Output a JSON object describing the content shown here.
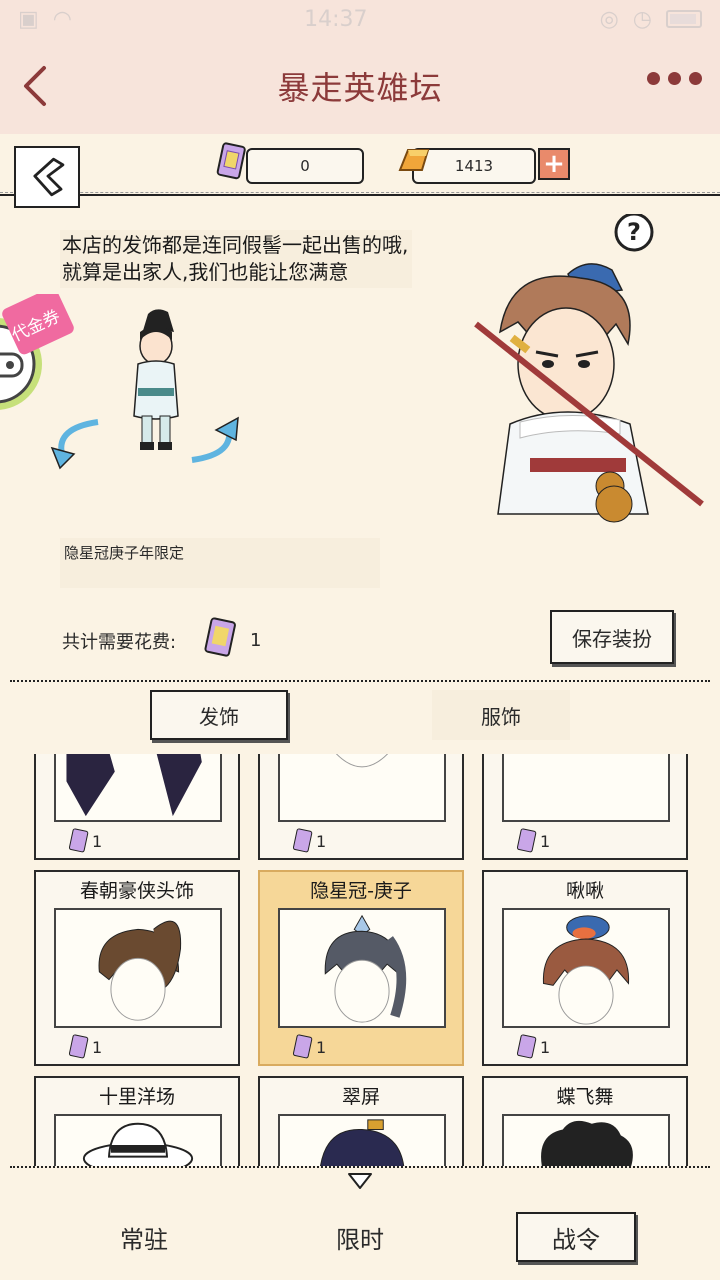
{
  "status": {
    "time": "14:37"
  },
  "app": {
    "title": "暴走英雄坛"
  },
  "currency": {
    "ticket": "0",
    "gold": "1413"
  },
  "shop": {
    "speech": "本店的发饰都是连同假髻一起出售的哦,就算是出家人,我们也能让您满意",
    "coupon_tab": "代金券",
    "selected_item_name": "隐星冠庚子年限定",
    "cost_label": "共计需要花费:",
    "cost_value": "1",
    "save_button": "保存装扮"
  },
  "categories": {
    "hair": "发饰",
    "clothes": "服饰"
  },
  "items": [
    {
      "name": "",
      "price": "1"
    },
    {
      "name": "",
      "price": "1"
    },
    {
      "name": "",
      "price": "1"
    },
    {
      "name": "春朝豪侠头饰",
      "price": "1"
    },
    {
      "name": "隐星冠-庚子",
      "price": "1"
    },
    {
      "name": "啾啾",
      "price": "1"
    },
    {
      "name": "十里洋场",
      "price": ""
    },
    {
      "name": "翠屏",
      "price": ""
    },
    {
      "name": "蝶飞舞",
      "price": ""
    }
  ],
  "bottom_tabs": {
    "regular": "常驻",
    "limited": "限时",
    "battle_pass": "战令"
  },
  "colors": {
    "accent": "#8c3a3a",
    "selected_card": "#f6d798",
    "background": "#fbf3e4"
  }
}
